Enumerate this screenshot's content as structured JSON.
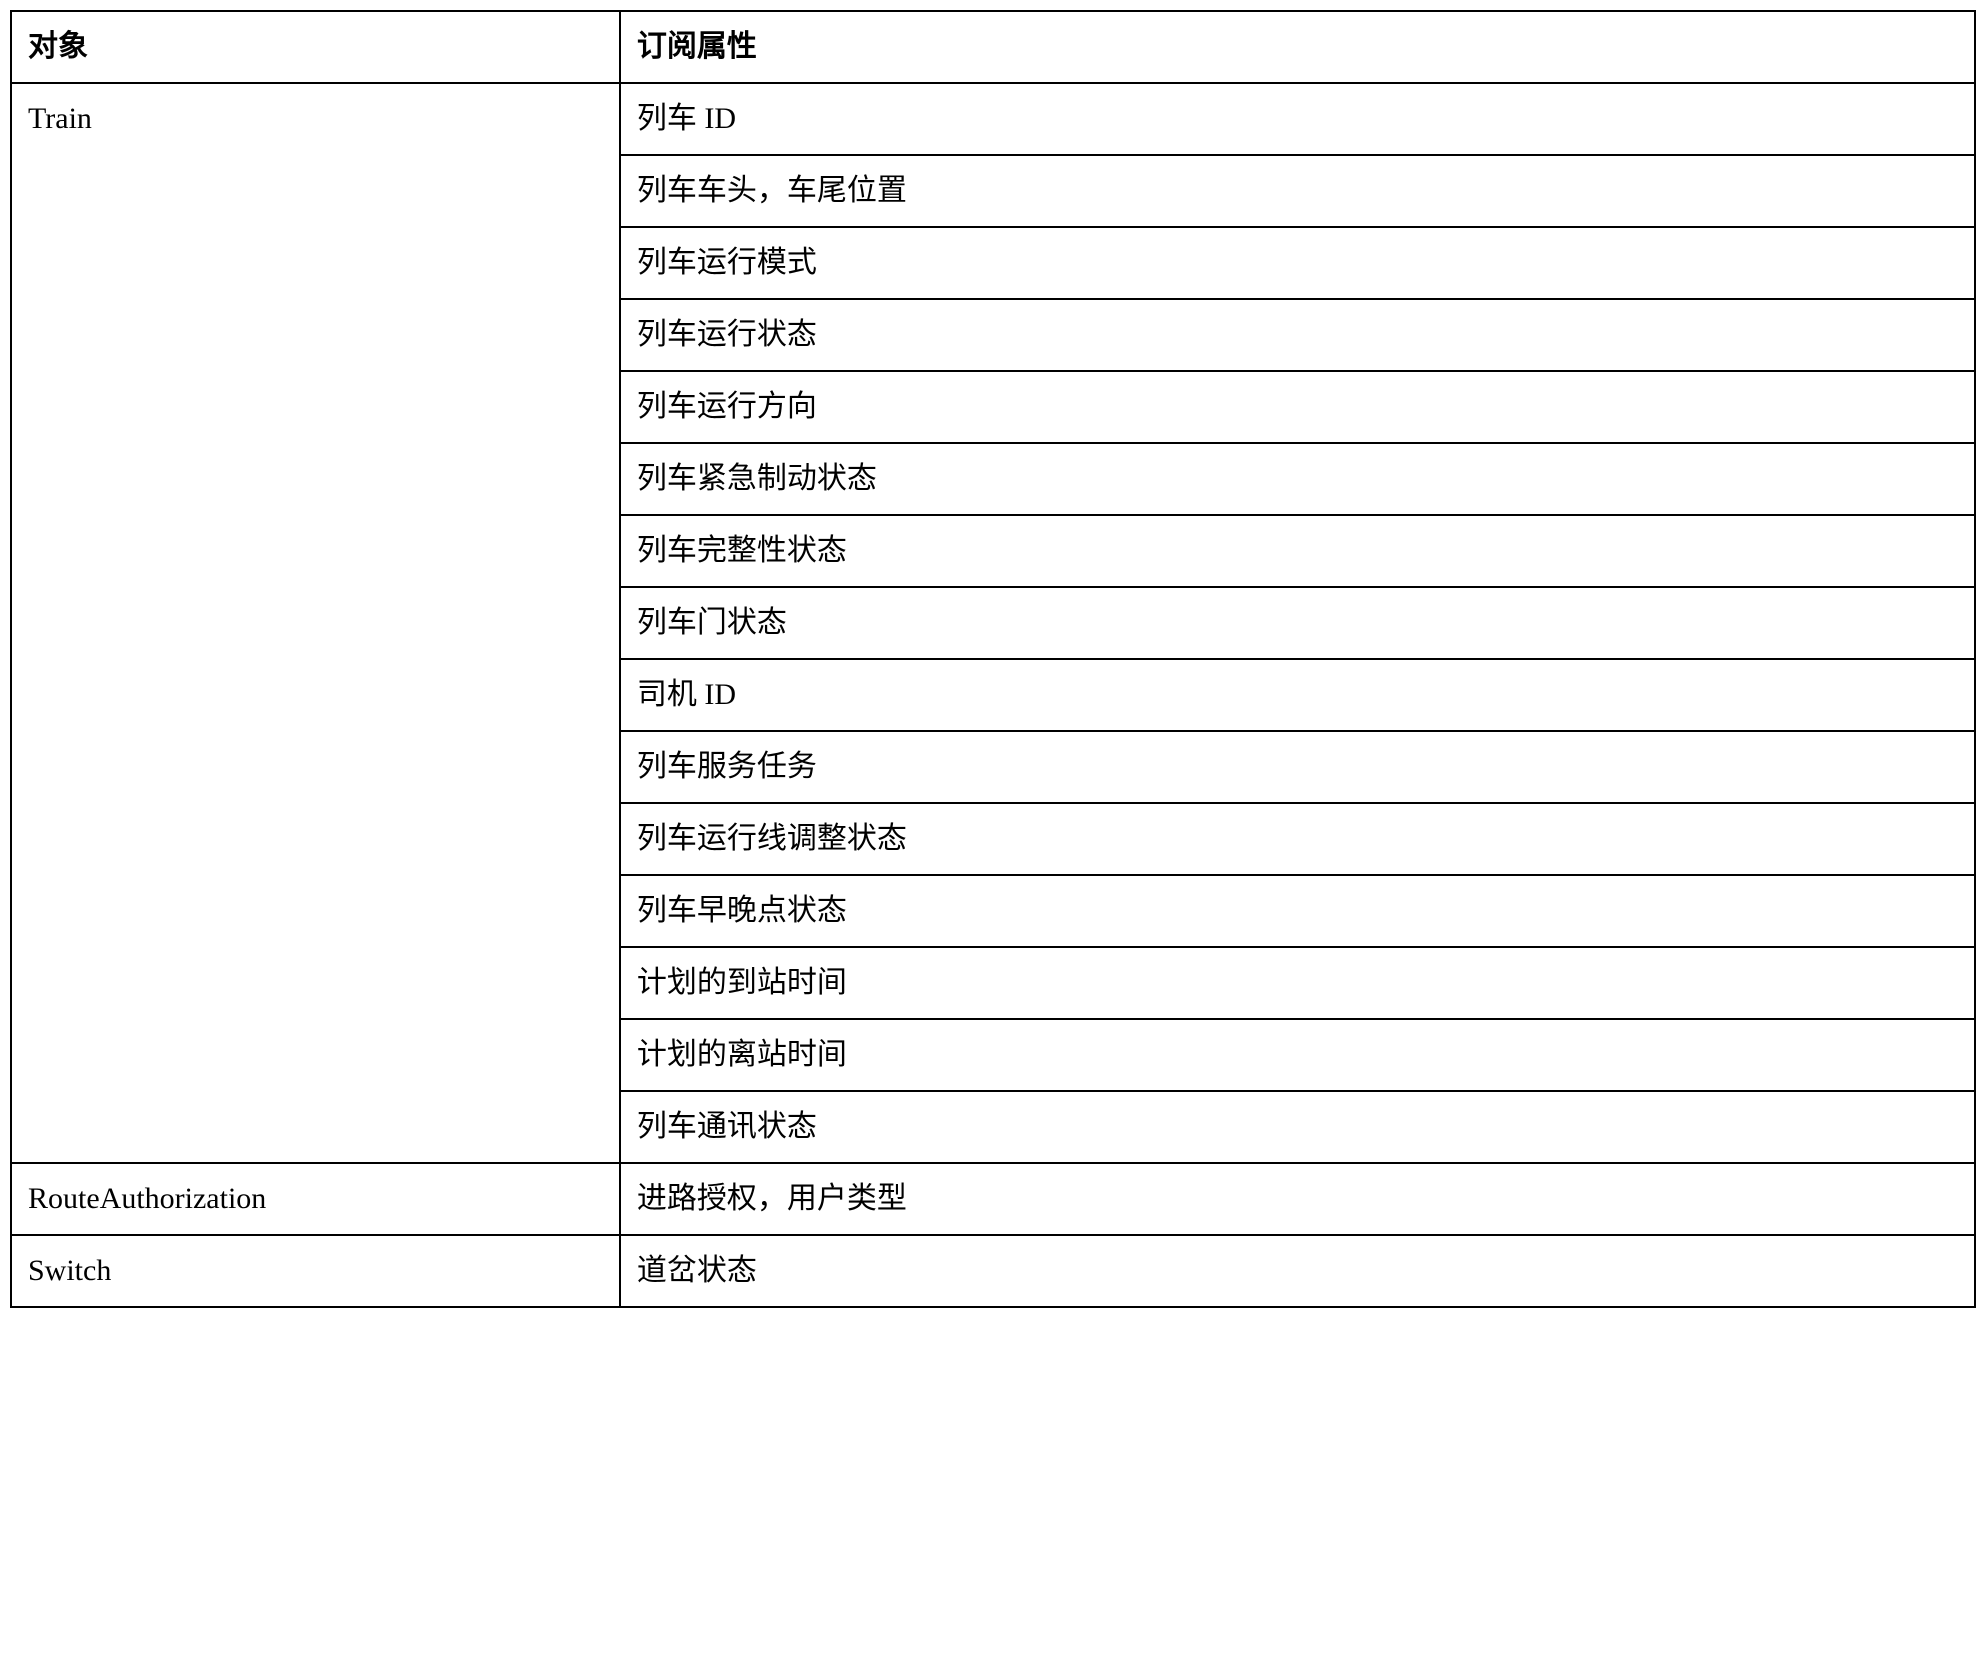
{
  "headers": {
    "object": "对象",
    "attribute": "订阅属性"
  },
  "rows": [
    {
      "object": "Train",
      "attributes": [
        "列车 ID",
        "列车车头，车尾位置",
        "列车运行模式",
        "列车运行状态",
        "列车运行方向",
        "列车紧急制动状态",
        "列车完整性状态",
        "列车门状态",
        "司机 ID",
        "列车服务任务",
        "列车运行线调整状态",
        "列车早晚点状态",
        "计划的到站时间",
        "计划的离站时间",
        "列车通讯状态"
      ]
    },
    {
      "object": "RouteAuthorization",
      "attributes": [
        "进路授权，用户类型"
      ]
    },
    {
      "object": "Switch",
      "attributes": [
        "道岔状态"
      ]
    }
  ]
}
